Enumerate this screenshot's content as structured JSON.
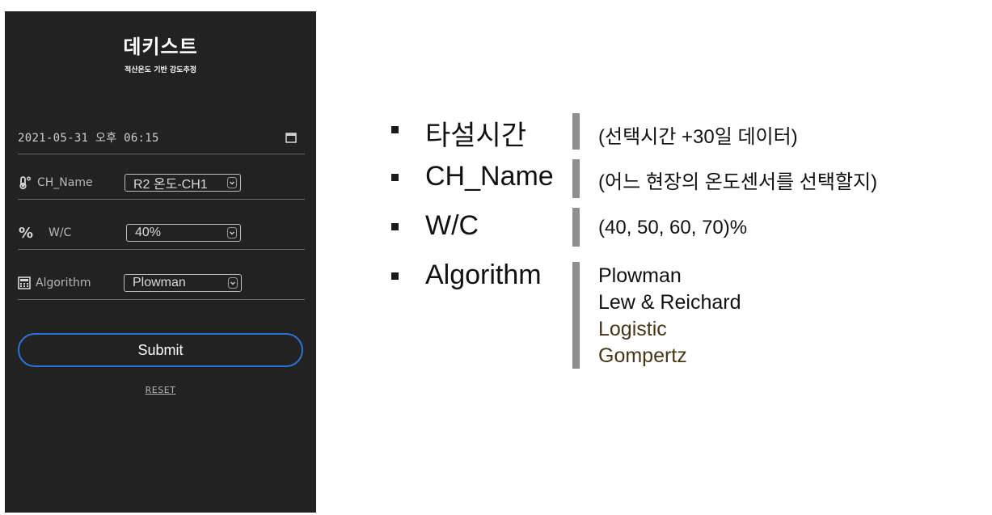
{
  "app": {
    "title": "데키스트",
    "subtitle": "적산온도 기반 강도추정"
  },
  "form": {
    "datetime": "2021-05-31 오후 06:15",
    "ch_name": {
      "label": "CH_Name",
      "selected": "R2 온도-CH1"
    },
    "wc": {
      "label": "W/C",
      "selected": "40%"
    },
    "algorithm": {
      "label": "Algorithm",
      "selected": "Plowman"
    },
    "submit_label": "Submit",
    "reset_label": "RESET"
  },
  "legend": {
    "items": [
      {
        "term": "타설시간",
        "desc": "(선택시간 +30일 데이터)"
      },
      {
        "term": "CH_Name",
        "desc": "(어느 현장의 온도센서를 선택할지)"
      },
      {
        "term": "W/C",
        "desc": "(40, 50, 60, 70)%"
      },
      {
        "term": "Algorithm",
        "options": [
          "Plowman",
          "Lew & Reichard",
          "Logistic",
          "Gompertz"
        ]
      }
    ]
  },
  "colors": {
    "panel_bg": "#222222",
    "accent_blue": "#2b73d6",
    "option_brown": "#4a3416"
  },
  "icons": [
    "calendar-icon",
    "thermometer-icon",
    "percent-icon",
    "calculator-icon",
    "chevron-down-icon"
  ]
}
